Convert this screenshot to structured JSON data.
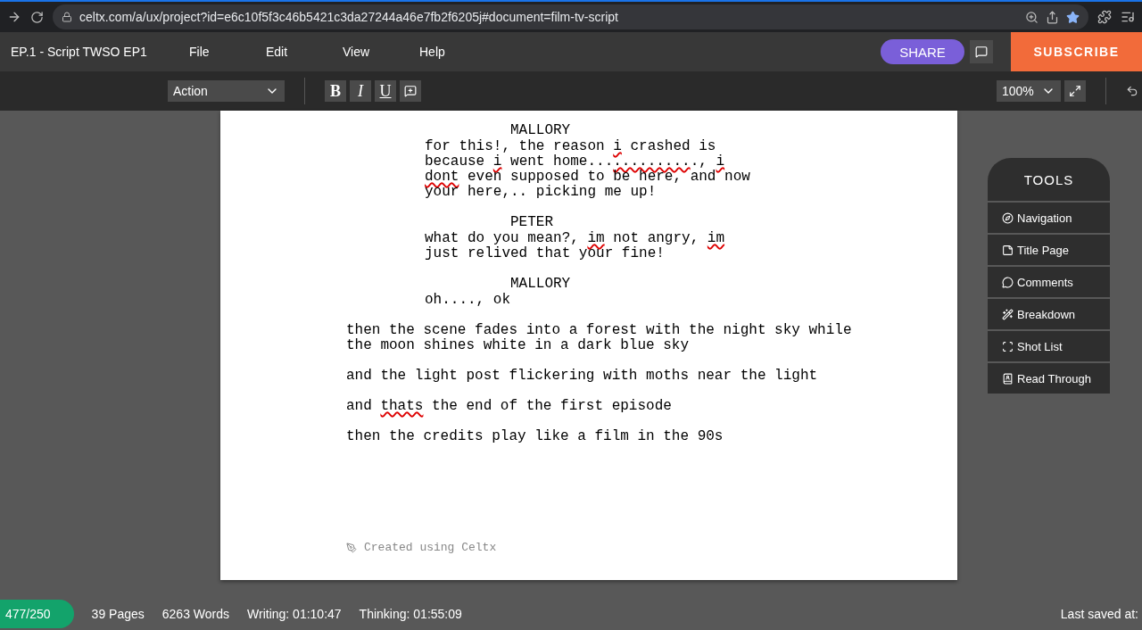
{
  "browser": {
    "url": "celtx.com/a/ux/project?id=e6c10f5f3c46b5421c3da27244a46e7fb2f6205j#document=film-tv-script"
  },
  "header": {
    "title": "EP.1 - Script TWSO EP1",
    "menu": [
      "File",
      "Edit",
      "View",
      "Help"
    ],
    "share": "SHARE",
    "subscribe": "SUBSCRIBE"
  },
  "toolbar": {
    "element_type": "Action",
    "format_buttons": [
      {
        "kind": "bold",
        "label": "B"
      },
      {
        "kind": "italic",
        "label": "I"
      },
      {
        "kind": "underline",
        "label": "U"
      },
      {
        "kind": "note"
      }
    ],
    "zoom": "100%"
  },
  "script": [
    {
      "kind": "character",
      "lines": [
        [
          {
            "text": "MALLORY",
            "misspelled": false
          }
        ]
      ]
    },
    {
      "kind": "dialogue",
      "lines": [
        [
          {
            "text": "for this!, the reason ",
            "misspelled": false
          },
          {
            "text": "i",
            "misspelled": true
          },
          {
            "text": " crashed is",
            "misspelled": false
          }
        ],
        [
          {
            "text": "because ",
            "misspelled": false
          },
          {
            "text": "i",
            "misspelled": true
          },
          {
            "text": " went home...",
            "misspelled": false
          },
          {
            "text": ".........",
            "misspelled": true
          },
          {
            "text": "., ",
            "misspelled": false
          },
          {
            "text": "i",
            "misspelled": true
          }
        ],
        [
          {
            "text": "dont",
            "misspelled": true
          },
          {
            "text": " even supposed to be here, and now",
            "misspelled": false
          }
        ],
        [
          {
            "text": "your here,.. picking me up!",
            "misspelled": false
          }
        ]
      ]
    },
    {
      "kind": "character",
      "lines": [
        [
          {
            "text": "PETER",
            "misspelled": false
          }
        ]
      ]
    },
    {
      "kind": "dialogue",
      "lines": [
        [
          {
            "text": "what do you mean?, ",
            "misspelled": false
          },
          {
            "text": "im",
            "misspelled": true
          },
          {
            "text": " not angry, ",
            "misspelled": false
          },
          {
            "text": "im",
            "misspelled": true
          }
        ],
        [
          {
            "text": "just relived that your fine!",
            "misspelled": false
          }
        ]
      ]
    },
    {
      "kind": "character",
      "lines": [
        [
          {
            "text": "MALLORY",
            "misspelled": false
          }
        ]
      ]
    },
    {
      "kind": "dialogue",
      "lines": [
        [
          {
            "text": "oh...., ok",
            "misspelled": false
          }
        ]
      ]
    },
    {
      "kind": "action",
      "lines": [
        [
          {
            "text": "then the scene fades into a forest with the night sky while",
            "misspelled": false
          }
        ],
        [
          {
            "text": "the moon shines white in a dark blue sky",
            "misspelled": false
          }
        ]
      ]
    },
    {
      "kind": "action",
      "lines": [
        [
          {
            "text": "and the light post flickering with moths near the light",
            "misspelled": false
          }
        ]
      ]
    },
    {
      "kind": "action",
      "lines": [
        [
          {
            "text": "and ",
            "misspelled": false
          },
          {
            "text": "thats",
            "misspelled": true
          },
          {
            "text": " the end of the first episode",
            "misspelled": false
          }
        ]
      ]
    },
    {
      "kind": "action",
      "lines": [
        [
          {
            "text": "then the credits play like a film in the 90s",
            "misspelled": false
          }
        ]
      ]
    }
  ],
  "footer_note": "Created using Celtx",
  "tools": {
    "title": "TOOLS",
    "items": [
      {
        "kind": "navigation",
        "label": "Navigation"
      },
      {
        "kind": "title",
        "label": "Title Page"
      },
      {
        "kind": "comments",
        "label": "Comments"
      },
      {
        "kind": "breakdown",
        "label": "Breakdown"
      },
      {
        "kind": "shots",
        "label": "Shot List"
      },
      {
        "kind": "read",
        "label": "Read Through"
      }
    ]
  },
  "status_bar": {
    "count": "477/250",
    "pages": "39 Pages",
    "words": "6263 Words",
    "writing": "Writing: 01:10:47",
    "thinking": "Thinking: 01:55:09",
    "saved": "Last saved at:"
  }
}
